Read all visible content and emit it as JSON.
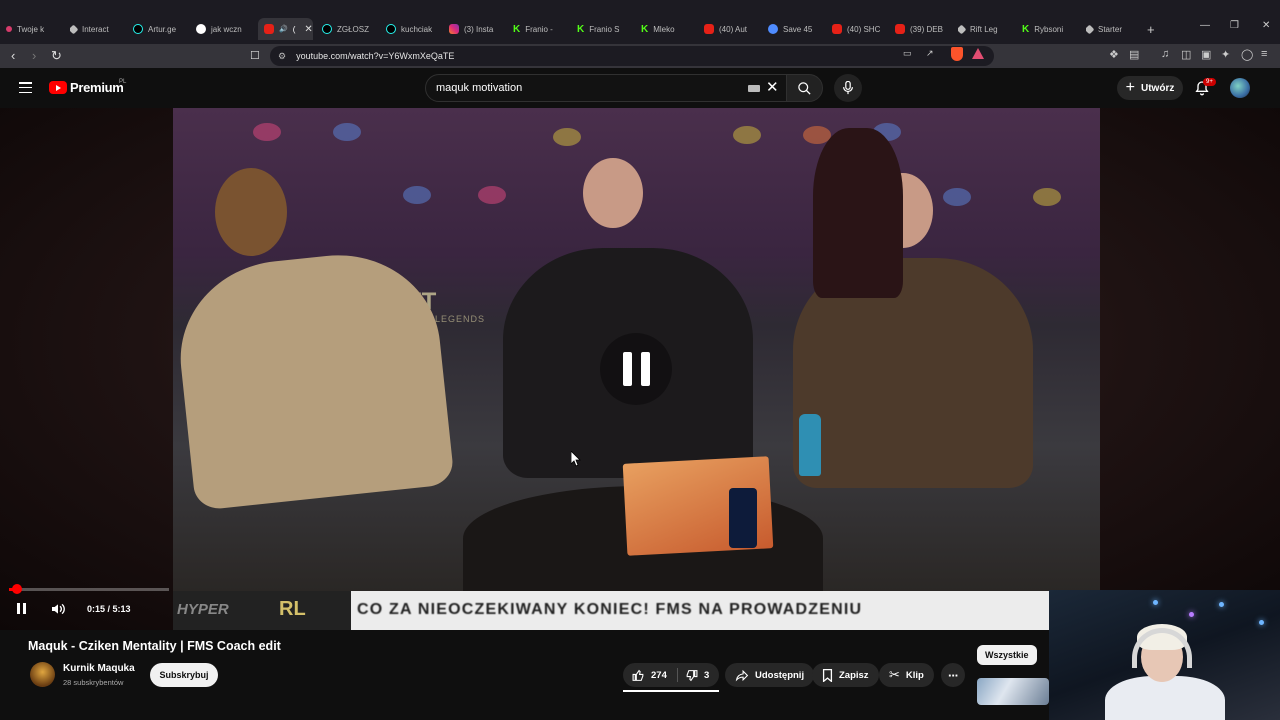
{
  "browser": {
    "tabs": [
      {
        "label": "Twoje k",
        "icon": "pink"
      },
      {
        "label": "Interact",
        "icon": "gray"
      },
      {
        "label": "Artur.ge",
        "icon": "tt"
      },
      {
        "label": "jak wczn",
        "icon": "g"
      },
      {
        "label": "(",
        "icon": "yt",
        "active": true
      },
      {
        "label": "ZGŁOSZ",
        "icon": "tt"
      },
      {
        "label": "kuchciak",
        "icon": "tt"
      },
      {
        "label": "(3) Insta",
        "icon": "ig"
      },
      {
        "label": "Franio -",
        "icon": "kick"
      },
      {
        "label": "Franio S",
        "icon": "kick"
      },
      {
        "label": "Mleko",
        "icon": "kick"
      },
      {
        "label": "(40) Aut",
        "icon": "yt"
      },
      {
        "label": "Save 45",
        "icon": "blue"
      },
      {
        "label": "(40) SHC",
        "icon": "yt"
      },
      {
        "label": "(39) DEB",
        "icon": "yt"
      },
      {
        "label": "Rift Leg",
        "icon": "gray"
      },
      {
        "label": "Rybsoni",
        "icon": "kick"
      },
      {
        "label": "Starter",
        "icon": "gray"
      }
    ],
    "url": "youtube.com/watch?v=Y6WxmXeQaTE"
  },
  "youtube": {
    "logo_text": "Premium",
    "country_code": "PL",
    "search_value": "maquk motivation",
    "create_label": "Utwórz",
    "notif_count": "9+"
  },
  "video": {
    "ticker_brand": "RL",
    "ticker_prefix": "HYPER",
    "ticker_text": "CO ZA NIEOCZEKIWANY KONIEC! FMS NA PROWADZENIU",
    "wall_brand": "RIFT",
    "wall_sub": "LEGENDS",
    "time": "0:15 / 5:13",
    "progress": 0.0479,
    "title": "Maquk - Cziken Mentality | FMS Coach edit"
  },
  "channel": {
    "name": "Kurnik Maquka",
    "subs": "28 subskrybentów",
    "subscribe_label": "Subskrybuj"
  },
  "actions": {
    "likes": "274",
    "dislikes": "3",
    "share": "Udostępnij",
    "save": "Zapisz",
    "clip": "Klip"
  },
  "sidebar": {
    "chip_all": "Wszystkie"
  }
}
